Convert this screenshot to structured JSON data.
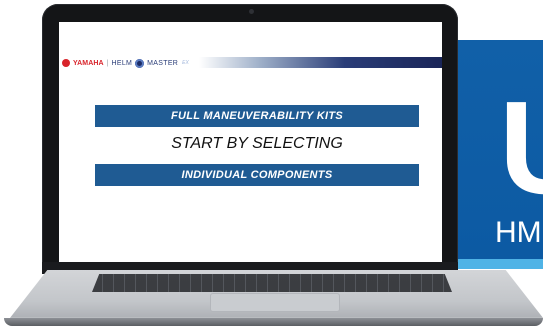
{
  "background_brand": {
    "big_letters": "U",
    "sub_text": "HM",
    "colors": {
      "panel": "#1160a8",
      "strip": "#4fb3e6"
    }
  },
  "screen": {
    "logo": {
      "brand": "YAMAHA",
      "separator": "|",
      "helm_word": "HELM",
      "master_word": "MASTER",
      "suffix": "EX",
      "icons": [
        "yamaha-emblem-icon",
        "helm-wheel-icon"
      ]
    },
    "banner_top": "FULL MANEUVERABILITY KITS",
    "headline": "START BY SELECTING",
    "banner_bottom": "INDIVIDUAL COMPONENTS",
    "colors": {
      "banner": "#1f5b93",
      "yamaha_red": "#d8232a",
      "navy": "#1a2558"
    }
  }
}
